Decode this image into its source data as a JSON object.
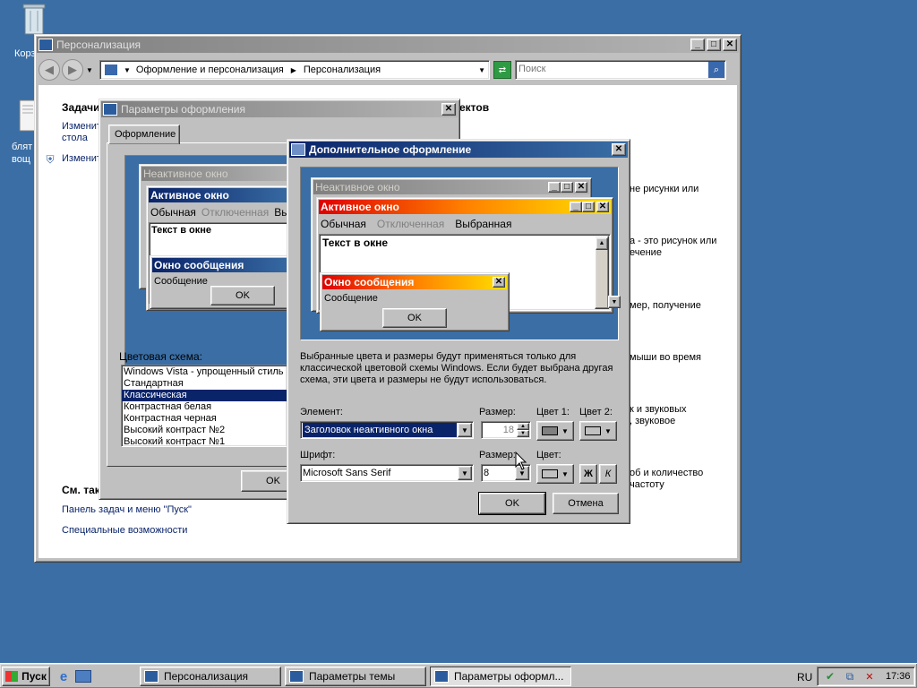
{
  "desktop": {
    "icon1_label": "Корз",
    "icon2_label": "блят",
    "icon2_label2": "вощ"
  },
  "personalization": {
    "title": "Персонализация",
    "breadcrumb1": "Оформление и персонализация",
    "breadcrumb2": "Персонализация",
    "search_placeholder": "Поиск",
    "tasks_heading": "Задачи",
    "task1_line1": "Изменит",
    "task1_line2": "стола",
    "task2": "Изменит",
    "heading_right": "ектов",
    "see_also": "См. так",
    "link_taskbar": "Панель задач и меню \"Пуск\"",
    "link_access": "Специальные возможности",
    "r1": "не рисунки или",
    "r2a": "а - это рисунок или",
    "r2b": "ечение",
    "r3": "мер, получение",
    "r4": "мыши во время",
    "r5a": "к и звуковых",
    "r5b": ", звуковое",
    "r6a": "об и количество",
    "r6b": "частоту"
  },
  "appearance": {
    "title": "Параметры оформления",
    "tab": "Оформление",
    "prev_inactive": "Неактивное окно",
    "prev_active": "Активное окно",
    "menu_normal": "Обычная",
    "menu_disabled": "Отключенная",
    "menu_sel": "Вы",
    "text_in_window": "Текст в окне",
    "msg_title": "Окно сообщения",
    "msg_text": "Сообщение",
    "ok": "OK",
    "scheme_label": "Цветовая схема:",
    "schemes": [
      "Windows Vista - упрощенный стиль",
      "Стандартная",
      "Классическая",
      "Контрастная белая",
      "Контрастная черная",
      "Высокий контраст №2",
      "Высокий контраст №1"
    ],
    "ok_button": "OK"
  },
  "advanced": {
    "title": "Дополнительное оформление",
    "prev_inactive": "Неактивное окно",
    "prev_active": "Активное окно",
    "menu_normal": "Обычная",
    "menu_disabled": "Отключенная",
    "menu_selected": "Выбранная",
    "text_in_window": "Текст в окне",
    "msg_title": "Окно сообщения",
    "msg_text": "Сообщение",
    "ok": "OK",
    "info_line1": "Выбранные цвета и размеры будут применяться только для",
    "info_line2": "классической цветовой схемы Windows. Если будет выбрана другая",
    "info_line3": "схема, эти цвета и размеры не будут использоваться.",
    "element_label": "Элемент:",
    "element_value": "Заголовок неактивного окна",
    "size_label": "Размер:",
    "size_value": "18",
    "color1_label": "Цвет 1:",
    "color2_label": "Цвет 2:",
    "font_label": "Шрифт:",
    "font_value": "Microsoft Sans Serif",
    "font_size_label": "Размер:",
    "font_size_value": "8",
    "color_label": "Цвет:",
    "bold_label": "Ж",
    "italic_label": "К",
    "ok_button": "OK",
    "cancel_button": "Отмена",
    "color1_swatch": "#808080",
    "color2_swatch": "#c0c0c0"
  },
  "taskbar": {
    "start": "Пуск",
    "tasks": [
      "Персонализация",
      "Параметры темы",
      "Параметры оформл..."
    ],
    "lang": "RU",
    "clock": "17:36"
  }
}
